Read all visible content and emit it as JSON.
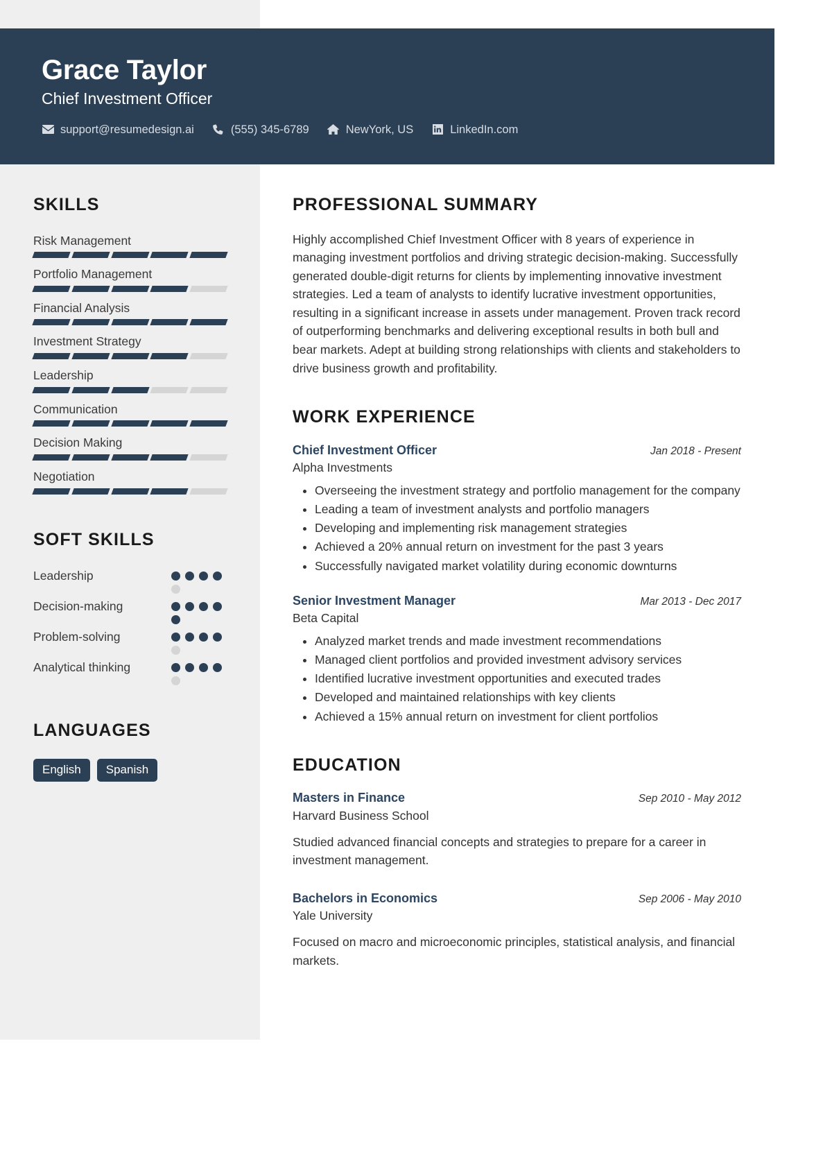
{
  "header": {
    "name": "Grace Taylor",
    "job_title": "Chief Investment Officer",
    "contacts": [
      {
        "icon": "envelope-icon",
        "text": "support@resumedesign.ai"
      },
      {
        "icon": "phone-icon",
        "text": "(555) 345-6789"
      },
      {
        "icon": "home-icon",
        "text": "NewYork, US"
      },
      {
        "icon": "linkedin-icon",
        "text": "LinkedIn.com"
      }
    ]
  },
  "sidebar": {
    "skills_heading": "SKILLS",
    "skills": [
      {
        "name": "Risk Management",
        "level": 5,
        "max": 5
      },
      {
        "name": "Portfolio Management",
        "level": 4,
        "max": 5
      },
      {
        "name": "Financial Analysis",
        "level": 5,
        "max": 5
      },
      {
        "name": "Investment Strategy",
        "level": 4,
        "max": 5
      },
      {
        "name": "Leadership",
        "level": 3,
        "max": 5
      },
      {
        "name": "Communication",
        "level": 5,
        "max": 5
      },
      {
        "name": "Decision Making",
        "level": 4,
        "max": 5
      },
      {
        "name": "Negotiation",
        "level": 4,
        "max": 5
      }
    ],
    "soft_skills_heading": "SOFT SKILLS",
    "soft_skills": [
      {
        "name": "Leadership",
        "level": 4,
        "max": 5
      },
      {
        "name": "Decision-making",
        "level": 5,
        "max": 5
      },
      {
        "name": "Problem-solving",
        "level": 4,
        "max": 5
      },
      {
        "name": "Analytical thinking",
        "level": 4,
        "max": 5
      }
    ],
    "languages_heading": "LANGUAGES",
    "languages": [
      "English",
      "Spanish"
    ]
  },
  "main": {
    "summary_heading": "PROFESSIONAL SUMMARY",
    "summary_text": "Highly accomplished Chief Investment Officer with 8 years of experience in managing investment portfolios and driving strategic decision-making. Successfully generated double-digit returns for clients by implementing innovative investment strategies. Led a team of analysts to identify lucrative investment opportunities, resulting in a significant increase in assets under management. Proven track record of outperforming benchmarks and delivering exceptional results in both bull and bear markets. Adept at building strong relationships with clients and stakeholders to drive business growth and profitability.",
    "experience_heading": "WORK EXPERIENCE",
    "experience": [
      {
        "title": "Chief Investment Officer",
        "date": "Jan 2018 - Present",
        "organization": "Alpha Investments",
        "bullets": [
          "Overseeing the investment strategy and portfolio management for the company",
          "Leading a team of investment analysts and portfolio managers",
          "Developing and implementing risk management strategies",
          "Achieved a 20% annual return on investment for the past 3 years",
          "Successfully navigated market volatility during economic downturns"
        ]
      },
      {
        "title": "Senior Investment Manager",
        "date": "Mar 2013 - Dec 2017",
        "organization": "Beta Capital",
        "bullets": [
          "Analyzed market trends and made investment recommendations",
          "Managed client portfolios and provided investment advisory services",
          "Identified lucrative investment opportunities and executed trades",
          "Developed and maintained relationships with key clients",
          "Achieved a 15% annual return on investment for client portfolios"
        ]
      }
    ],
    "education_heading": "EDUCATION",
    "education": [
      {
        "degree": "Masters in Finance",
        "date": "Sep 2010 - May 2012",
        "school": "Harvard Business School",
        "description": "Studied advanced financial concepts and strategies to prepare for a career in investment management."
      },
      {
        "degree": "Bachelors in Economics",
        "date": "Sep 2006 - May 2010",
        "school": "Yale University",
        "description": "Focused on macro and microeconomic principles, statistical analysis, and financial markets."
      }
    ]
  },
  "colors": {
    "primary": "#2b3f55",
    "accent": "#2b4562",
    "sidebar_bg": "#efefef",
    "bar_empty": "#d5d5d5"
  }
}
